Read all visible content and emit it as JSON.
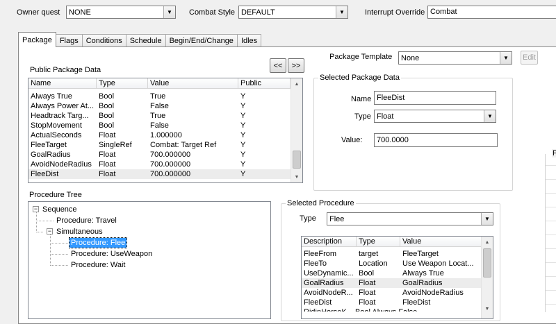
{
  "top_bar": {
    "owner_quest_label": "Owner quest",
    "owner_quest_value": "NONE",
    "combat_style_label": "Combat Style",
    "combat_style_value": "DEFAULT",
    "interrupt_override_label": "Interrupt Override",
    "interrupt_override_value": "Combat"
  },
  "tabs": [
    {
      "label": "Package",
      "active": true
    },
    {
      "label": "Flags",
      "active": false
    },
    {
      "label": "Conditions",
      "active": false
    },
    {
      "label": "Schedule",
      "active": false
    },
    {
      "label": "Begin/End/Change",
      "active": false
    },
    {
      "label": "Idles",
      "active": false
    }
  ],
  "package_template": {
    "label": "Package Template",
    "value": "None",
    "edit_label": "Edit"
  },
  "public_package_data": {
    "title": "Public Package Data",
    "prev_label": "<<",
    "next_label": ">>",
    "columns": [
      "Name",
      "Type",
      "Value",
      "Public"
    ],
    "rows": [
      [
        "Always True",
        "Bool",
        "True",
        "Y"
      ],
      [
        "Always Power At...",
        "Bool",
        "False",
        "Y"
      ],
      [
        "Headtrack Targ...",
        "Bool",
        "True",
        "Y"
      ],
      [
        "StopMovement",
        "Bool",
        "False",
        "Y"
      ],
      [
        "ActualSeconds",
        "Float",
        "1.000000",
        "Y"
      ],
      [
        "FleeTarget",
        "SingleRef",
        "Combat: Target Ref",
        "Y"
      ],
      [
        "GoalRadius",
        "Float",
        "700.000000",
        "Y"
      ],
      [
        "AvoidNodeRadius",
        "Float",
        "700.000000",
        "Y"
      ],
      [
        "FleeDist",
        "Float",
        "700.000000",
        "Y"
      ]
    ],
    "selected_row": 8
  },
  "selected_package_data": {
    "title": "Selected Package Data",
    "name_label": "Name",
    "name_value": "FleeDist",
    "type_label": "Type",
    "type_value": "Float",
    "value_label": "Value:",
    "value_value": "700.0000"
  },
  "procedure_tree": {
    "title": "Procedure Tree",
    "nodes": [
      {
        "label": "Sequence",
        "expander": "−"
      },
      {
        "label": "Procedure: Travel"
      },
      {
        "label": "Simultaneous",
        "expander": "−"
      },
      {
        "label": "Procedure: Flee",
        "selected": true
      },
      {
        "label": "Procedure: UseWeapon"
      },
      {
        "label": "Procedure: Wait"
      }
    ]
  },
  "selected_procedure": {
    "title": "Selected Procedure",
    "type_label": "Type",
    "type_value": "Flee",
    "columns": [
      "Description",
      "Type",
      "Value"
    ],
    "rows": [
      [
        "FleeFrom",
        "target",
        "FleeTarget"
      ],
      [
        "FleeTo",
        "Location",
        "Use Weapon Locat..."
      ],
      [
        "UseDynamic...",
        "Bool",
        "Always True"
      ],
      [
        "GoalRadius",
        "Float",
        "GoalRadius"
      ],
      [
        "AvoidNodeR...",
        "Float",
        "AvoidNodeRadius"
      ],
      [
        "FleeDist",
        "Float",
        "FleeDist"
      ]
    ],
    "partial_row": "RidinHorseK...  Bool  Always False",
    "selected_row": 3
  },
  "right_group_title": "F"
}
